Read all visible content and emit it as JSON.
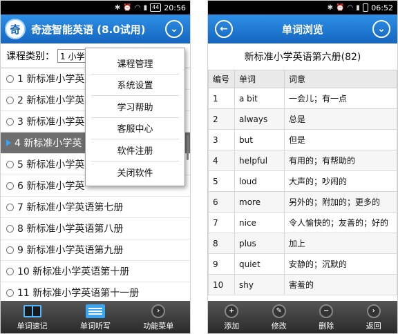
{
  "left": {
    "status": {
      "time": "20:56",
      "battery": "44"
    },
    "app_title": "奇迹智能英语 (8.0试用)",
    "logo_char": "奇",
    "course_type_label": "课程类别：",
    "course_type_value": "1 小学",
    "books": [
      {
        "label": "1 新标准小学英",
        "selected": false
      },
      {
        "label": "2 新标准小学英",
        "selected": false
      },
      {
        "label": "3 新标准小学英",
        "selected": false
      },
      {
        "label": "4 新标准小学英",
        "selected": true
      },
      {
        "label": "5 新标准小学英",
        "selected": false
      },
      {
        "label": "6 新标准小学英",
        "selected": false
      },
      {
        "label": "7 新标准小学英语第七册",
        "selected": false
      },
      {
        "label": "8 新标准小学英语第八册",
        "selected": false
      },
      {
        "label": "9 新标准小学英语第九册",
        "selected": false
      },
      {
        "label": "10 新标准小学英语第十册",
        "selected": false
      },
      {
        "label": "11 新标准小学英语第十一册",
        "selected": false
      }
    ],
    "menu": [
      "课程管理",
      "系统设置",
      "学习帮助",
      "客服中心",
      "软件注册",
      "关闭软件"
    ],
    "tabs": [
      {
        "label": "单词速记",
        "icon": "book-icon"
      },
      {
        "label": "单词听写",
        "icon": "notebook-icon"
      },
      {
        "label": "功能菜单",
        "icon": "arrow-right-icon"
      }
    ]
  },
  "right": {
    "status": {
      "time": "06:52"
    },
    "screen_title": "单词浏览",
    "book_title": "新标准小学英语第六册(82)",
    "columns": [
      "编号",
      "单词",
      "词意"
    ],
    "rows": [
      [
        "1",
        "a bit",
        "一会儿；有一点"
      ],
      [
        "2",
        "always",
        "总是"
      ],
      [
        "3",
        "but",
        "但是"
      ],
      [
        "4",
        "helpful",
        "有用的；有帮助的"
      ],
      [
        "5",
        "loud",
        "大声的；吵闹的"
      ],
      [
        "6",
        "more",
        "另外的；附加的；更多的"
      ],
      [
        "7",
        "nice",
        "令人愉快的；友善的；好的"
      ],
      [
        "8",
        "plus",
        "加上"
      ],
      [
        "9",
        "quiet",
        "安静的；沉默的"
      ],
      [
        "10",
        "shy",
        "害羞的"
      ]
    ],
    "tabs": [
      {
        "label": "添加",
        "glyph": "+"
      },
      {
        "label": "修改",
        "glyph": "✎"
      },
      {
        "label": "删除",
        "glyph": "−"
      },
      {
        "label": "返回",
        "glyph": "›"
      }
    ]
  },
  "colors": {
    "titlebar": "#1f7fd8",
    "accent": "#3aa6f2",
    "bottombar": "#3a3a3a"
  }
}
